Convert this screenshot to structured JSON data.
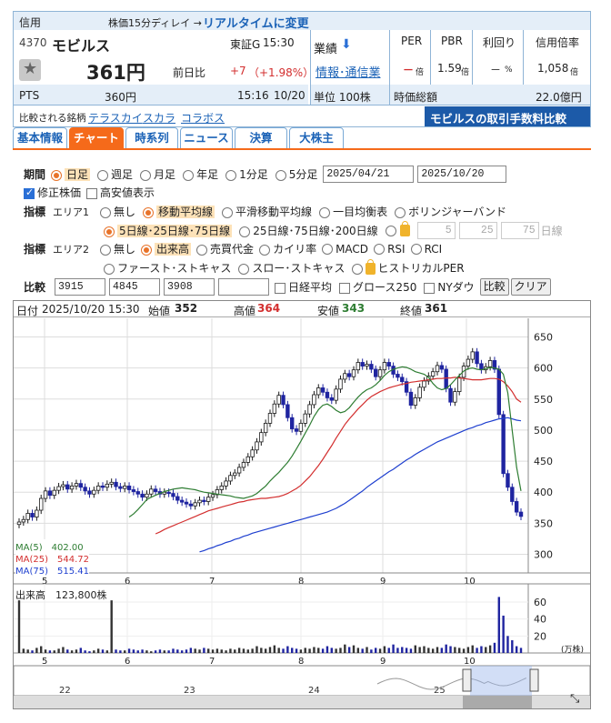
{
  "header": {
    "type": "信用",
    "delay_note": "株価15分ディレイ →",
    "realtime_link": "リアルタイムに変更"
  },
  "stock": {
    "code": "4370",
    "name": "モビルス",
    "market": "東証G",
    "time": "15:30",
    "price": "361円",
    "prev_label": "前日比",
    "change": "+7",
    "change_pct": "（+1.98%）",
    "pts_label": "PTS",
    "pts_price": "360円",
    "pts_time": "15:16",
    "pts_date": "10/20",
    "gyoseki": "業績",
    "info_link": "情報･通信業",
    "unit": "単位 100株",
    "market_cap_label": "時価総額",
    "market_cap": "22.0億円",
    "compare_label": "比較される銘柄",
    "compare_items": [
      "テラスカイ",
      "スカラ",
      "コラボス"
    ],
    "fee_banner": "モビルスの取引手数料比較"
  },
  "metrics": {
    "headers": [
      "PER",
      "PBR",
      "利回り",
      "信用倍率"
    ],
    "values": [
      "－",
      "1.59",
      "－",
      "1,058"
    ],
    "units": [
      "倍",
      "倍",
      "%",
      "倍"
    ]
  },
  "tabs": [
    "基本情報",
    "チャート",
    "時系列",
    "ニュース",
    "決算",
    "大株主"
  ],
  "controls": {
    "period_label": "期間",
    "period_options": [
      "日足",
      "週足",
      "月足",
      "年足",
      "1分足",
      "5分足"
    ],
    "date_from": "2025/04/21",
    "date_to": "2025/10/20",
    "adj_label": "修正株価",
    "highlow_label": "高安値表示",
    "indicator_label": "指標",
    "area1_label": "エリア1",
    "area1_options": [
      "無し",
      "移動平均線",
      "平滑移動平均線",
      "一目均衡表",
      "ボリンジャーバンド"
    ],
    "ma_options": [
      "5日線･25日線･75日線",
      "25日線･75日線･200日線"
    ],
    "ma_custom": [
      "5",
      "25",
      "75"
    ],
    "ma_custom_unit": "日線",
    "area2_label": "エリア2",
    "area2_options": [
      "無し",
      "出来高",
      "売買代金",
      "カイリ率",
      "MACD",
      "RSI",
      "RCI"
    ],
    "area2_options2": [
      "ファースト･ストキャス",
      "スロー･ストキャス",
      "ヒストリカルPER"
    ],
    "compare_label": "比較",
    "compare_inputs": [
      "3915",
      "4845",
      "3908",
      ""
    ],
    "compare_checks": [
      "日経平均",
      "グロース250",
      "NYダウ"
    ],
    "compare_button": "比較",
    "clear_button": "クリア"
  },
  "chart_info": {
    "date_label": "日付",
    "date": "2025/10/20 15:30",
    "open_label": "始値",
    "open": "352",
    "high_label": "高値",
    "high": "364",
    "low_label": "安値",
    "low": "343",
    "close_label": "終値",
    "close": "361",
    "ma5": "MA(5)　402.00",
    "ma25": "MA(25)　544.72",
    "ma75": "MA(75)　515.41",
    "volume_label": "出来高",
    "volume": "123,800株",
    "volume_unit": "(万株)"
  },
  "colors": {
    "up": "#1a1a1a",
    "down": "#1f24a0",
    "ma5": "#2e7d32",
    "ma25": "#d32f2f",
    "ma75": "#1e3fcf",
    "accent": "#f56a1a",
    "link": "#1c63b7"
  },
  "chart_data": {
    "type": "candlestick",
    "x_ticks": [
      "5",
      "6",
      "7",
      "8",
      "9",
      "10"
    ],
    "y_ticks": [
      300,
      350,
      400,
      450,
      500,
      550,
      600,
      650
    ],
    "ylim": [
      270,
      680
    ],
    "volume_ticks": [
      20,
      40,
      60
    ],
    "navigator_ticks": [
      "22",
      "23",
      "24",
      "25"
    ],
    "close": [
      352,
      356,
      366,
      360,
      371,
      390,
      402,
      395,
      403,
      409,
      412,
      405,
      410,
      414,
      408,
      402,
      397,
      403,
      410,
      408,
      413,
      416,
      409,
      406,
      410,
      404,
      401,
      397,
      392,
      397,
      405,
      401,
      397,
      400,
      398,
      393,
      387,
      384,
      381,
      378,
      383,
      387,
      385,
      392,
      396,
      404,
      410,
      418,
      427,
      431,
      440,
      448,
      457,
      468,
      481,
      496,
      511,
      527,
      542,
      556,
      541,
      520,
      502,
      498,
      511,
      526,
      541,
      557,
      568,
      561,
      552,
      548,
      566,
      582,
      591,
      586,
      597,
      609,
      603,
      606,
      598,
      586,
      597,
      609,
      603,
      590,
      585,
      578,
      561,
      540,
      552,
      569,
      579,
      587,
      594,
      604,
      598,
      567,
      545,
      562,
      585,
      603,
      614,
      626,
      607,
      597,
      602,
      612,
      598,
      525,
      430,
      408,
      385,
      368,
      361
    ],
    "ma5": [
      360,
      365,
      372,
      380,
      388,
      392,
      395,
      398,
      401,
      403,
      405,
      406,
      407,
      406,
      405,
      404,
      402,
      400,
      399,
      398,
      397,
      396,
      395,
      394,
      392,
      391,
      390,
      392,
      394,
      398,
      404,
      410,
      418,
      425,
      432,
      440,
      448,
      458,
      470,
      482,
      495,
      508,
      522,
      533,
      540,
      542,
      538,
      532,
      528,
      530,
      536,
      545,
      553,
      560,
      565,
      568,
      573,
      580,
      588,
      594,
      598,
      600,
      602,
      601,
      598,
      594,
      592,
      590,
      585,
      575,
      568,
      565,
      567,
      573,
      581,
      588,
      595,
      599,
      600,
      598,
      597,
      599,
      601,
      600,
      598,
      590,
      560,
      500,
      440,
      402
    ],
    "ma25": [
      333,
      336,
      340,
      343,
      346,
      349,
      352,
      355,
      358,
      361,
      364,
      367,
      370,
      372,
      374,
      376,
      378,
      380,
      382,
      384,
      385,
      387,
      388,
      389,
      390,
      390,
      391,
      392,
      393,
      395,
      398,
      402,
      406,
      411,
      418,
      425,
      434,
      443,
      453,
      464,
      475,
      487,
      498,
      509,
      518,
      526,
      534,
      541,
      548,
      554,
      558,
      562,
      565,
      568,
      570,
      572,
      574,
      575,
      577,
      578,
      579,
      580,
      581,
      582,
      583,
      583,
      584,
      584,
      585,
      584,
      583,
      582,
      581,
      581,
      581,
      582,
      583,
      583,
      582,
      578,
      571,
      562,
      550,
      545
    ],
    "ma75": [
      304,
      306,
      309,
      311,
      314,
      316,
      319,
      321,
      324,
      326,
      329,
      331,
      334,
      336,
      338,
      340,
      342,
      344,
      346,
      348,
      350,
      352,
      354,
      356,
      358,
      360,
      362,
      364,
      366,
      368,
      371,
      374,
      378,
      382,
      387,
      392,
      397,
      402,
      408,
      413,
      418,
      423,
      428,
      433,
      437,
      442,
      447,
      452,
      456,
      461,
      465,
      469,
      473,
      477,
      481,
      484,
      487,
      490,
      493,
      496,
      499,
      502,
      504,
      507,
      509,
      512,
      514,
      516,
      518,
      519,
      520,
      518,
      516,
      515
    ],
    "volume": [
      62,
      5,
      4,
      3,
      6,
      8,
      4,
      3,
      3,
      5,
      7,
      4,
      3,
      4,
      6,
      3,
      2,
      3,
      5,
      4,
      3,
      62,
      4,
      3,
      3,
      5,
      4,
      3,
      4,
      3,
      2,
      3,
      4,
      3,
      3,
      5,
      4,
      3,
      4,
      6,
      5,
      4,
      6,
      5,
      4,
      5,
      4,
      3,
      5,
      4,
      6,
      5,
      4,
      5,
      8,
      6,
      5,
      7,
      9,
      6,
      5,
      8,
      6,
      5,
      4,
      6,
      5,
      7,
      6,
      5,
      8,
      6,
      5,
      6,
      10,
      7,
      9,
      6,
      5,
      7,
      4,
      6,
      5,
      8,
      6,
      10,
      6,
      7,
      6,
      5,
      9,
      7,
      8,
      6,
      5,
      7,
      6,
      10,
      8,
      7,
      6,
      5,
      7,
      9,
      6,
      8,
      7,
      9,
      12,
      66,
      44,
      20,
      15,
      8,
      6
    ]
  }
}
